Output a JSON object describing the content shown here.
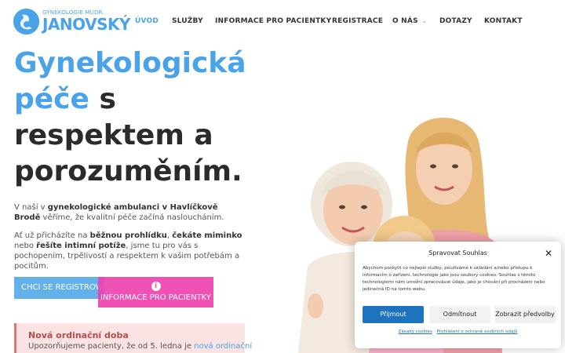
{
  "logo": {
    "small": "GYNEKOLOGIE MUDR.",
    "big": "JANOVSKÝ"
  },
  "nav": {
    "items": [
      {
        "label": "ÚVOD"
      },
      {
        "label": "SLUŽBY"
      },
      {
        "label": "INFORMACE PRO PACIENTKY"
      },
      {
        "label": "REGISTRACE"
      },
      {
        "label": "O NÁS"
      },
      {
        "label": "DOTAZY"
      },
      {
        "label": "KONTAKT"
      }
    ],
    "active": "ÚVOD"
  },
  "hero": {
    "title_blue_1": "Gynekologická",
    "title_blue_2": "péče",
    "title_dark_1": " s",
    "title_dark_2": "respektem a",
    "title_dark_3": "porozuměním.",
    "p1_pre": "V naší v ",
    "p1_bold": "gynekologické ambulanci v Havlíčkově Brodě",
    "p1_post": " věříme, že kvalitní péče začíná nasloucháním.",
    "p2_pre": "Ať už přicházíte na ",
    "p2_bold1": "běžnou prohlídku",
    "p2_mid1": ", ",
    "p2_bold2": "čekáte miminko",
    "p2_mid2": " nebo ",
    "p2_bold3": "řešíte intimní potíže",
    "p2_post": ", jsme tu pro vás s pochopením, trpělivostí a respektem k vašim potřebám a pocitům.",
    "button_register": "CHCI SE REGISTROVAT",
    "button_info": "INFORMACE PRO PACIENTKY"
  },
  "notice": {
    "title": "Nová ordinační doba",
    "text_pre": "Upozorňujeme pacienty, že od 5. ledna je ",
    "text_link": "nová ordinační"
  },
  "cookie": {
    "title": "Spravovat Souhlas",
    "text": "Abychom poskytli co nejlepší služby, používáme k ukládání a/nebo přístupu k informacím o zařízení, technologie jako jsou soubory cookies. Souhlas s těmito technologiemi nám umožní zpracovávat údaje, jako je chování při procházení nebo jedinečná ID na tomto webu.",
    "accept": "Přijmout",
    "deny": "Odmítnout",
    "prefs": "Zobrazit předvolby",
    "link_cookies": "Zásady cookies",
    "link_privacy": "Prohlášení o ochraně osobních údajů"
  },
  "colors": {
    "accent": "#4aa3e8",
    "pink": "#ee3fae",
    "cookie_primary": "#1e73be"
  }
}
